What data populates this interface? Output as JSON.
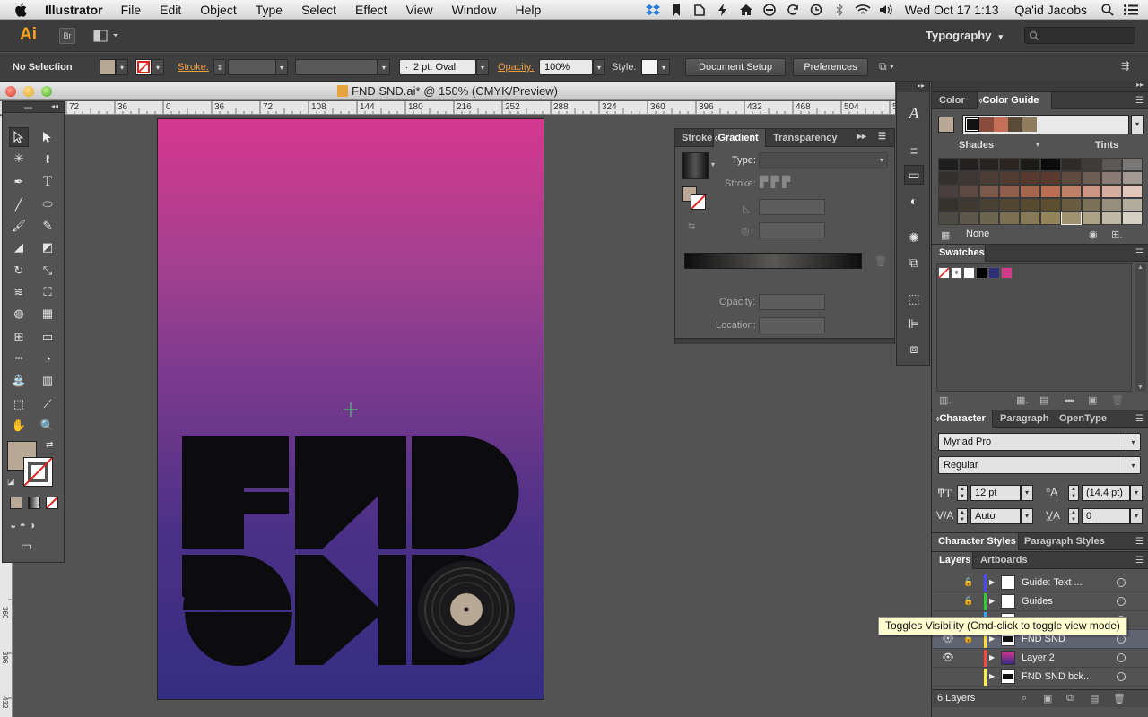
{
  "menubar": {
    "app": "Illustrator",
    "items": [
      "File",
      "Edit",
      "Object",
      "Type",
      "Select",
      "Effect",
      "View",
      "Window",
      "Help"
    ],
    "clock": "Wed Oct 17  1:13",
    "user": "Qa'id Jacobs"
  },
  "appbar": {
    "logo": "Ai",
    "bridge": "Br",
    "workspace": "Typography"
  },
  "control": {
    "selection": "No Selection",
    "stroke_label": "Stroke:",
    "brush": "2 pt. Oval",
    "opacity_label": "Opacity:",
    "opacity_value": "100%",
    "style_label": "Style:",
    "doc_setup": "Document Setup",
    "preferences": "Preferences",
    "fill_color": "#b7a995"
  },
  "document": {
    "title": "FND SND.ai* @ 150% (CMYK/Preview)",
    "ruler_ticks": [
      "72",
      "36",
      "0",
      "36",
      "72",
      "108",
      "144",
      "180",
      "216",
      "252",
      "288",
      "324",
      "360",
      "396",
      "432",
      "468",
      "504",
      "54"
    ],
    "vruler_ticks": [
      "360",
      "396",
      "432"
    ],
    "artwork_text": [
      "FND",
      "SND"
    ]
  },
  "gradient_panel": {
    "tabs": [
      "Stroke",
      "Gradient",
      "Transparency"
    ],
    "type_label": "Type:",
    "stroke_label": "Stroke:",
    "opacity_label": "Opacity:",
    "location_label": "Location:"
  },
  "color_panel": {
    "tabs": [
      "Color",
      "Color Guide"
    ],
    "shades_label": "Shades",
    "tints_label": "Tints",
    "none_label": "None",
    "guide_colors": [
      "#111111",
      "#8a4c3c",
      "#c56e58",
      "#5a4a38",
      "#8f7d5d"
    ],
    "grid": [
      [
        "#1f1f1f",
        "#242020",
        "#272321",
        "#2a2520",
        "#1c1b18",
        "#0c0c0c",
        "#2d2a27",
        "#3e3b38",
        "#5b5856",
        "#7a7876"
      ],
      [
        "#343030",
        "#3e3632",
        "#4b3c34",
        "#523b31",
        "#57392e",
        "#5b3a2e",
        "#5f4a40",
        "#6e5d54",
        "#8a7c75",
        "#a39993"
      ],
      [
        "#4a4040",
        "#5e4a42",
        "#7a5a4c",
        "#8f5f4c",
        "#a5664f",
        "#b96e54",
        "#c18068",
        "#ca9582",
        "#d6ae9f",
        "#e2c7bc"
      ],
      [
        "#35322c",
        "#3f3a31",
        "#494234",
        "#504632",
        "#564b30",
        "#5b4f30",
        "#685d41",
        "#7b7158",
        "#968f7b",
        "#b1ac9d"
      ],
      [
        "#4d4a43",
        "#5d584b",
        "#6d6550",
        "#7a6f51",
        "#877a56",
        "#938559",
        "#9f9270",
        "#aca288",
        "#c0b9a6",
        "#d5d1c5"
      ]
    ]
  },
  "swatches": {
    "title": "Swatches",
    "colors": [
      "#ffffff",
      "#000000",
      "#2e2f7a",
      "#d23a8c"
    ]
  },
  "character": {
    "tabs": [
      "Character",
      "Paragraph",
      "OpenType"
    ],
    "font": "Myriad Pro",
    "style": "Regular",
    "size": "12 pt",
    "leading": "(14.4 pt)",
    "kerning": "Auto",
    "tracking": "0"
  },
  "styles_tabs": [
    "Character Styles",
    "Paragraph Styles"
  ],
  "layers": {
    "tabs": [
      "Layers",
      "Artboards"
    ],
    "rows": [
      {
        "name": "Guide: Text ...",
        "color": "#4a4aff",
        "visible": false,
        "locked": true
      },
      {
        "name": "Guides",
        "color": "#33cc33",
        "visible": false,
        "locked": true
      },
      {
        "name": "",
        "color": "#33aaff",
        "visible": false,
        "locked": false
      },
      {
        "name": "FND SND",
        "color": "#ffdd33",
        "visible": true,
        "locked": true
      },
      {
        "name": "Layer 2",
        "color": "#ff4444",
        "visible": true,
        "locked": false
      },
      {
        "name": "FND SND bck..",
        "color": "#ffee44",
        "visible": false,
        "locked": false
      }
    ],
    "count": "6 Layers",
    "tooltip": "Toggles Visibility (Cmd-click to toggle view mode)"
  }
}
